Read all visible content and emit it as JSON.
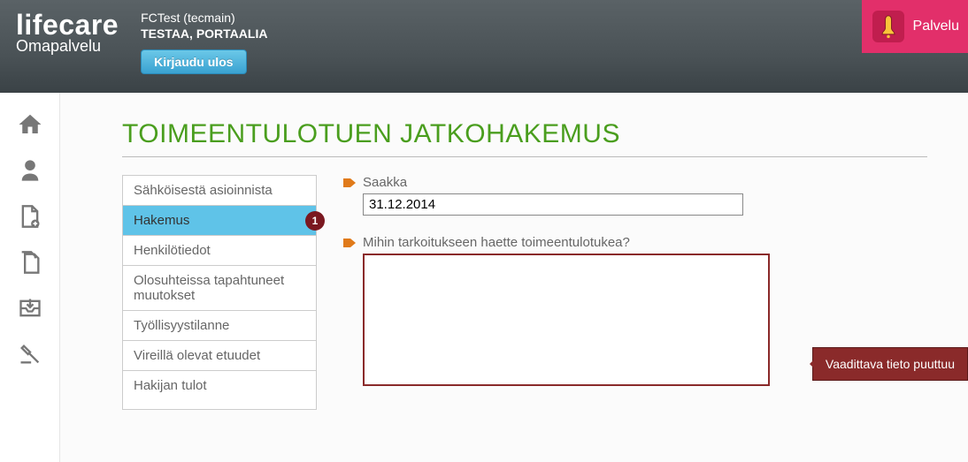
{
  "header": {
    "logo_main": "lifecare",
    "logo_sub": "Omapalvelu",
    "user_context": "FCTest (tecmain)",
    "user_name": "TESTAA, PORTAALIA",
    "logout_label": "Kirjaudu ulos",
    "alert_label": "Palvelu"
  },
  "page": {
    "title": "TOIMEENTULOTUEN JATKOHAKEMUS"
  },
  "steps": [
    {
      "label": "Sähköisestä asioinnista"
    },
    {
      "label": "Hakemus",
      "active": true,
      "badge": "1"
    },
    {
      "label": "Henkilötiedot"
    },
    {
      "label": "Olosuhteissa tapahtuneet muutokset"
    },
    {
      "label": "Työllisyystilanne"
    },
    {
      "label": "Vireillä olevat etuudet"
    },
    {
      "label": "Hakijan tulot"
    }
  ],
  "form": {
    "field_until_label": "Saakka",
    "field_until_value": "31.12.2014",
    "field_purpose_label": "Mihin tarkoitukseen haette toimeentulotukea?",
    "field_purpose_value": ""
  },
  "tooltip": {
    "error_text": "Vaadittava tieto puuttuu"
  }
}
